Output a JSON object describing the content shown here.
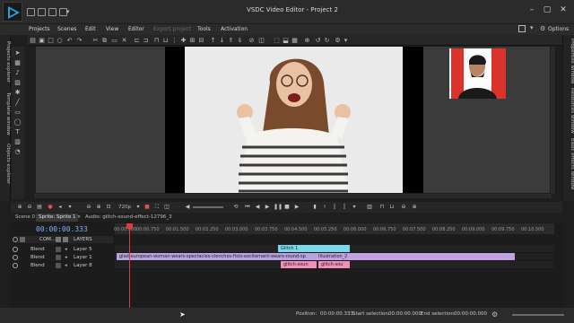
{
  "window": {
    "title": "VSDC Video Editor - Project 2"
  },
  "menu": {
    "items": [
      {
        "label": "Projects",
        "enabled": true
      },
      {
        "label": "Scenes",
        "enabled": true
      },
      {
        "label": "Edit",
        "enabled": true
      },
      {
        "label": "View",
        "enabled": true
      },
      {
        "label": "Editor",
        "enabled": true
      },
      {
        "label": "Export project",
        "enabled": false
      },
      {
        "label": "Tools",
        "enabled": true
      },
      {
        "label": "Activation",
        "enabled": true
      }
    ],
    "options_label": "Options"
  },
  "left_tabs": [
    "Projects explorer",
    "Template window",
    "Objects explorer"
  ],
  "right_tabs": [
    "Properties window",
    "Resources window",
    "Basic effects window"
  ],
  "transport": {
    "zoom": "720p"
  },
  "tabs": [
    {
      "label": "Scene 0",
      "active": false
    },
    {
      "label": "Sprite: Sprite 1",
      "active": true
    },
    {
      "label": "Audio: glitch-sound-effect-12796_3",
      "active": false
    }
  ],
  "timeline": {
    "timecode": "00:00:00.333",
    "ruler_ticks": [
      "00:00.000",
      "00:00.750",
      "00:01.500",
      "00:02.250",
      "00:03.000",
      "00:03.750",
      "00:04.500",
      "00:05.250",
      "00:06.000",
      "00:06.750",
      "00:07.500",
      "00:08.250",
      "00:09.000",
      "00:09.750",
      "00:10.500"
    ],
    "header": {
      "com_label": "COM...",
      "layers_label": "LAYERS"
    },
    "rows": [
      {
        "blend": "Blend",
        "name": "Layer 5"
      },
      {
        "blend": "Blend",
        "name": "Layer 1"
      },
      {
        "blend": "Blend",
        "name": "Layer 8"
      }
    ],
    "clips": {
      "glitch1": "Glitch 1",
      "main_video": "glad-european-woman-wears-spectacles-clenches-fists-excitement-wears-round-sp",
      "illustration": "Illustration_2",
      "sound1": "glitch-soun",
      "sound2": "glitch-sou"
    }
  },
  "status": {
    "position_label": "Position:",
    "position_value": "00:00:00.333",
    "start_label": "Start selection:",
    "start_value": "00:00:00.000",
    "end_label": "End selection:",
    "end_value": "00:00:00.000"
  },
  "colors": {
    "accent_blue": "#7fb0ff",
    "glitch_clip": "#7ad8ea",
    "video_clip": "#b8a3df",
    "illustration_clip": "#c3a0e0",
    "audio_clip": "#f08fb8",
    "playhead": "#e03a3a",
    "pip_background": "#d9332b"
  }
}
